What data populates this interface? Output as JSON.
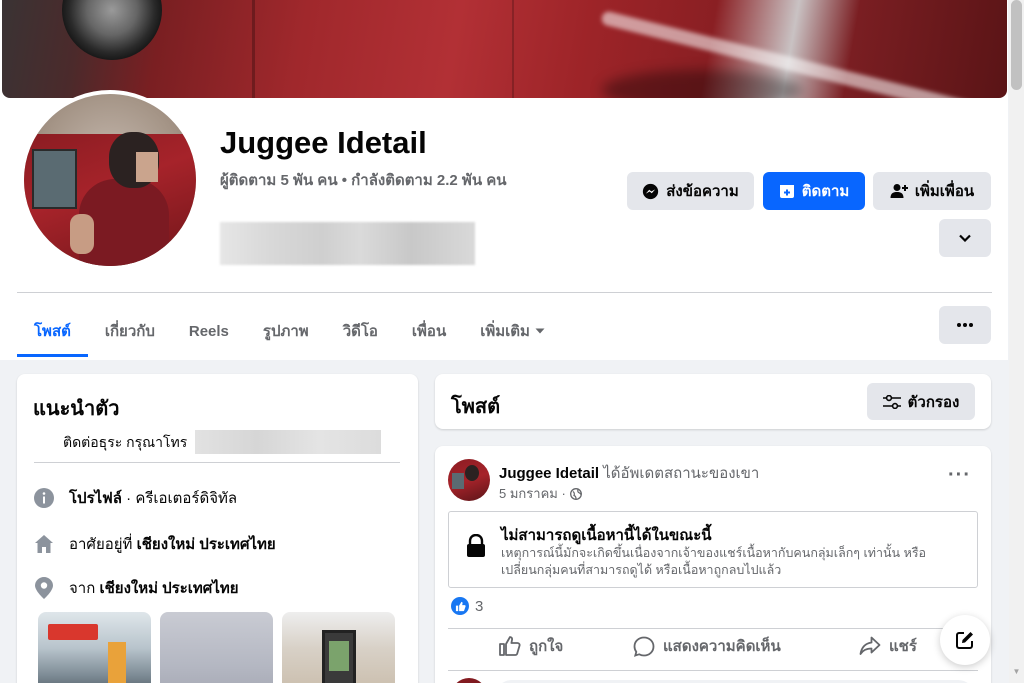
{
  "profile": {
    "name": "Juggee Idetail",
    "follow_info": "ผู้ติดตาม 5 พัน คน • กำลังติดตาม 2.2 พัน คน"
  },
  "actions": {
    "message": "ส่งข้อความ",
    "follow": "ติดตาม",
    "add_friend": "เพิ่มเพื่อน"
  },
  "tabs": [
    {
      "label": "โพสต์"
    },
    {
      "label": "เกี่ยวกับ"
    },
    {
      "label": "Reels"
    },
    {
      "label": "รูปภาพ"
    },
    {
      "label": "วิดีโอ"
    },
    {
      "label": "เพื่อน"
    },
    {
      "label": "เพิ่มเติม"
    }
  ],
  "intro": {
    "title": "แนะนำตัว",
    "contact": "ติดต่อธุระ กรุณาโทร",
    "profile_label": "โปรไฟล์",
    "profile_value": " · ครีเอเตอร์ดิจิทัล",
    "lives_prefix": "อาศัยอยู่ที่ ",
    "lives_value": "เชียงใหม่ ประเทศไทย",
    "from_prefix": "จาก ",
    "from_value": "เชียงใหม่ ประเทศไทย"
  },
  "posts": {
    "title": "โพสต์",
    "filter": "ตัวกรอง"
  },
  "post": {
    "author": "Juggee Idetail",
    "action_text": " ได้อัพเดตสถานะของเขา",
    "date": "5 มกราคม ·",
    "unavailable_title": "ไม่สามารถดูเนื้อหานี้ได้ในขณะนี้",
    "unavailable_desc": "เหตุการณ์นี้มักจะเกิดขึ้นเนื่องจากเจ้าของแชร์เนื้อหากับคนกลุ่มเล็กๆ เท่านั้น หรือเปลี่ยนกลุ่มคนที่สามารถดูได้ หรือเนื้อหาถูกลบไปแล้ว",
    "reaction_count": "3",
    "like": "ถูกใจ",
    "comment": "แสดงความคิดเห็น",
    "share": "แชร์"
  },
  "colors": {
    "accent": "#0866ff",
    "secondary_text": "#65676b",
    "button_gray": "#e4e6eb"
  }
}
